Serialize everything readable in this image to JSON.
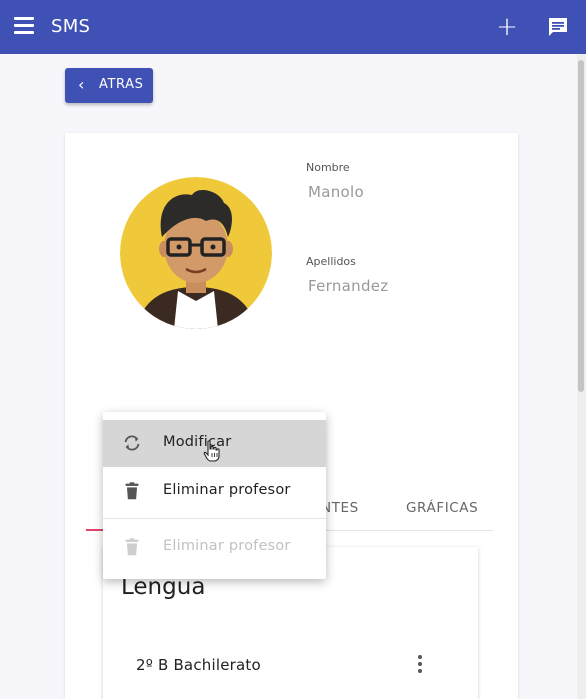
{
  "toolbar": {
    "title": "SMS",
    "menu_icon": "hamburger-menu-icon",
    "add_icon": "plus-icon",
    "message_icon": "chat-message-icon",
    "color": "#3f51b5"
  },
  "back_button": {
    "label": "ATRAS",
    "icon": "chevron-left-icon"
  },
  "profile": {
    "nombre_label": "Nombre",
    "nombre_value": "Manolo",
    "apellidos_label": "Apellidos",
    "apellidos_value": "Fernandez",
    "avatar_icon": "avatar-glasses-icon"
  },
  "tabs": [
    {
      "label": "NTES"
    },
    {
      "label": "GRÁFICAS"
    }
  ],
  "tab_indicator_color": "#e0446a",
  "subject": {
    "title": "Lengua",
    "group": "2º B Bachilerato",
    "more_icon": "more-vert-icon"
  },
  "context_menu": {
    "items": [
      {
        "label": "Modificar",
        "icon": "sync-icon",
        "state": "hover"
      },
      {
        "label": "Eliminar profesor",
        "icon": "trash-icon",
        "state": "normal"
      },
      {
        "label": "Eliminar profesor",
        "icon": "trash-icon",
        "state": "disabled"
      }
    ]
  }
}
